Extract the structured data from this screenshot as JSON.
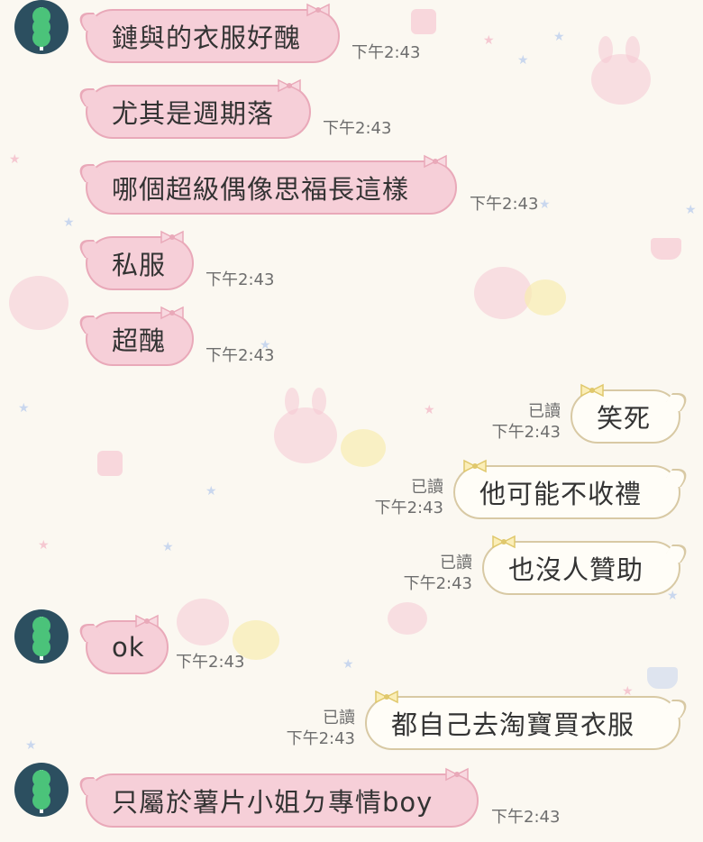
{
  "colors": {
    "background": "#fbf8f1",
    "incoming_bubble": "#f6cfd8",
    "incoming_border": "#e9a9b9",
    "outgoing_bubble": "#fffdf7",
    "outgoing_border": "#d8c9a4",
    "avatar_bg": "#2c4f60",
    "avatar_icon": "#4bc37a",
    "meta_text": "#6e6e6e"
  },
  "avatar": {
    "icon": "tanghulu-icon"
  },
  "read_label": "已讀",
  "messages": [
    {
      "direction": "in",
      "text": "鏈與的衣服好醜",
      "time": "下午2:43",
      "avatar": true
    },
    {
      "direction": "in",
      "text": "尤其是週期落",
      "time": "下午2:43",
      "avatar": false
    },
    {
      "direction": "in",
      "text": "哪個超級偶像思福長這樣",
      "time": "下午2:43",
      "avatar": false
    },
    {
      "direction": "in",
      "text": "私服",
      "time": "下午2:43",
      "avatar": false
    },
    {
      "direction": "in",
      "text": "超醜",
      "time": "下午2:43",
      "avatar": false
    },
    {
      "direction": "out",
      "text": "笑死",
      "time": "下午2:43",
      "read": true
    },
    {
      "direction": "out",
      "text": "他可能不收禮",
      "time": "下午2:43",
      "read": true
    },
    {
      "direction": "out",
      "text": "也沒人贊助",
      "time": "下午2:43",
      "read": true
    },
    {
      "direction": "in",
      "text": "ok",
      "time": "下午2:43",
      "avatar": true
    },
    {
      "direction": "out",
      "text": "都自己去淘寶買衣服",
      "time": "下午2:43",
      "read": true
    },
    {
      "direction": "in",
      "text": "只屬於薯片小姐ㄉ專情boy",
      "time": "下午2:43",
      "avatar": true
    }
  ]
}
